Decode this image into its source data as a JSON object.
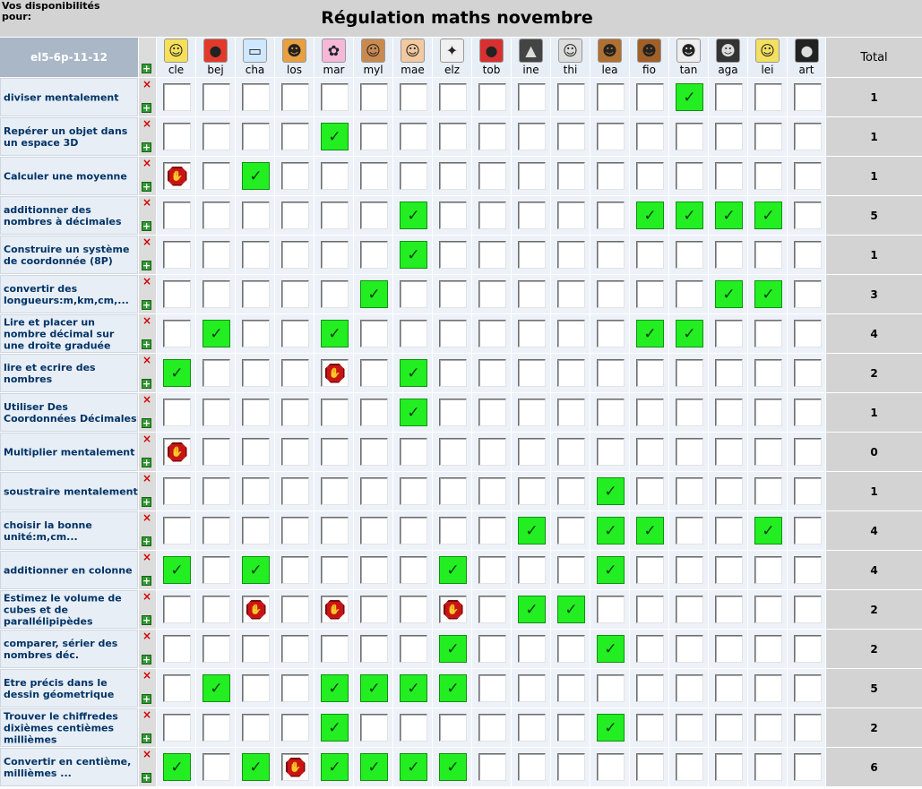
{
  "header": {
    "dispo_label": "Vos disponibilités pour:",
    "title": "Régulation maths novembre",
    "class_label": "el5-6p-11-12",
    "total_label": "Total"
  },
  "icons": {
    "remove": "×",
    "add": "+",
    "check": "✓",
    "stop": "✋"
  },
  "colors": {
    "acquired": "#22ee22",
    "stop": "#c81414",
    "class_header": "#a9b7c6"
  },
  "students": [
    {
      "name": "cle",
      "icon": "☺",
      "bg": "#f6e05a"
    },
    {
      "name": "bej",
      "icon": "●",
      "bg": "#e23a2a"
    },
    {
      "name": "cha",
      "icon": "▭",
      "bg": "#cfe8ff"
    },
    {
      "name": "los",
      "icon": "☻",
      "bg": "#e8a040"
    },
    {
      "name": "mar",
      "icon": "✿",
      "bg": "#f6b8d8"
    },
    {
      "name": "myl",
      "icon": "☺",
      "bg": "#c98a50"
    },
    {
      "name": "mae",
      "icon": "☺",
      "bg": "#f2c9a0"
    },
    {
      "name": "elz",
      "icon": "✦",
      "bg": "#f0f0f0"
    },
    {
      "name": "tob",
      "icon": "●",
      "bg": "#d83030"
    },
    {
      "name": "ine",
      "icon": "▲",
      "bg": "#444444"
    },
    {
      "name": "thi",
      "icon": "☺",
      "bg": "#dddddd"
    },
    {
      "name": "lea",
      "icon": "☻",
      "bg": "#b07030"
    },
    {
      "name": "fio",
      "icon": "☻",
      "bg": "#a06028"
    },
    {
      "name": "tan",
      "icon": "☻",
      "bg": "#eeeeee"
    },
    {
      "name": "aga",
      "icon": "☻",
      "bg": "#333333"
    },
    {
      "name": "lei",
      "icon": "☺",
      "bg": "#f3e060"
    },
    {
      "name": "art",
      "icon": "●",
      "bg": "#222222"
    }
  ],
  "rows": [
    {
      "label": "diviser mentalement",
      "total": "1",
      "cells": "-------------x---"
    },
    {
      "label": "Repérer un objet dans un espace 3D",
      "total": "1",
      "cells": "----x------------"
    },
    {
      "label": "Calculer une moyenne",
      "total": "1",
      "cells": "s-x--------------"
    },
    {
      "label": "additionner des nombres à décimales",
      "total": "5",
      "cells": "------x-----xxxx-"
    },
    {
      "label": "Construire un système de coordonnée (8P)",
      "total": "1",
      "cells": "------x----------"
    },
    {
      "label": "convertir des longueurs:m,km,cm,...",
      "total": "3",
      "cells": "-----x--------xx-"
    },
    {
      "label": "Lire et placer un nombre décimal sur une droite graduée",
      "total": "4",
      "cells": "-x--x-------xx---"
    },
    {
      "label": "lire et ecrire des nombres",
      "total": "2",
      "cells": "x---s-x----------"
    },
    {
      "label": "Utiliser Des Coordonnées Décimales",
      "total": "1",
      "cells": "------x----------"
    },
    {
      "label": "Multiplier mentalement",
      "total": "0",
      "cells": "s----------------"
    },
    {
      "label": "soustraire mentalement",
      "total": "1",
      "cells": "-----------x-----"
    },
    {
      "label": "choisir la bonne unité:m,cm...",
      "total": "4",
      "cells": "---------x-xx--x-"
    },
    {
      "label": "additionner en colonne",
      "total": "4",
      "cells": "x-x----x---x-----"
    },
    {
      "label": "Estimez le volume de cubes et de parallélipipèdes",
      "total": "2",
      "cells": "--s-s--s-xx------"
    },
    {
      "label": "comparer, sérier des nombres déc.",
      "total": "2",
      "cells": "-------x---x-----"
    },
    {
      "label": "Etre précis dans le dessin géometrique",
      "total": "5",
      "cells": "-x--xxxx---------"
    },
    {
      "label": "Trouver le chiffredes dixièmes centièmes millièmes",
      "total": "2",
      "cells": "----x------x-----"
    },
    {
      "label": "Convertir en centième, millièmes ...",
      "total": "6",
      "cells": "x-xsxxxx---------"
    }
  ]
}
